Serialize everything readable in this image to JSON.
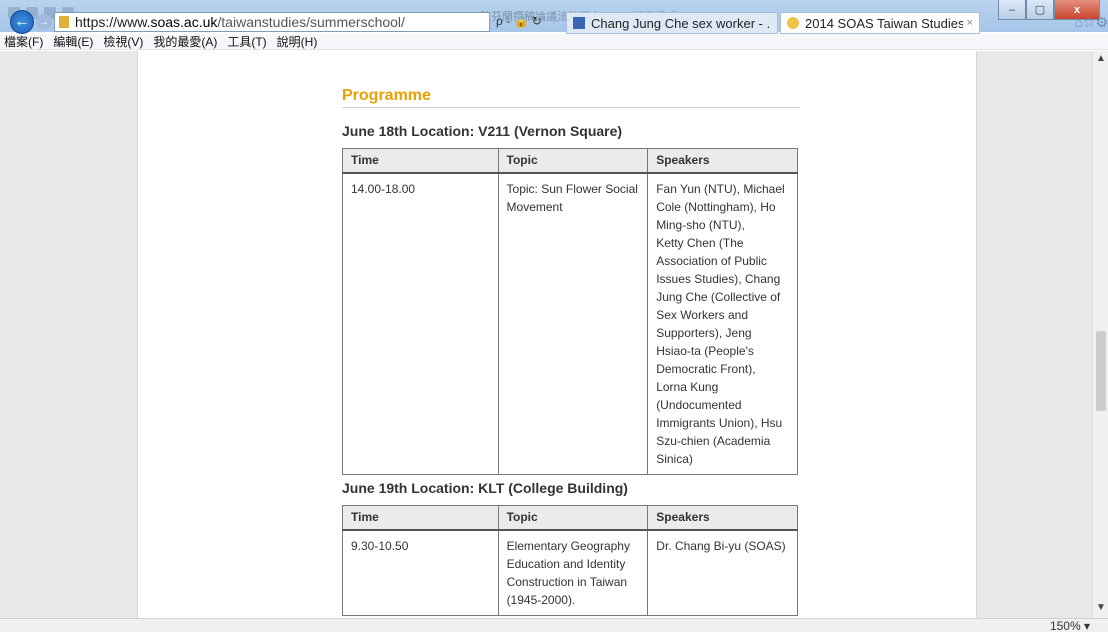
{
  "window": {
    "title": "陳芬蘭撰稿論議法律研究.docx [相容模式] - Word",
    "controls": {
      "minimize": "–",
      "maximize": "▢",
      "close": "x"
    }
  },
  "browser": {
    "address": {
      "scheme": "https://www.",
      "host": "soas.ac.uk",
      "path": "/taiwanstudies/summerschool/"
    },
    "address_tools": "ρ - 🔒 ↻",
    "tabs": [
      {
        "label": "Chang Jung Che sex worker - ...",
        "active": false
      },
      {
        "label": "2014 SOAS Taiwan Studies ...",
        "close": "×",
        "active": true
      }
    ],
    "right_icons": "⌂☆⚙"
  },
  "menubar": [
    "檔案(F)",
    "編輯(E)",
    "檢視(V)",
    "我的最愛(A)",
    "工具(T)",
    "說明(H)"
  ],
  "page": {
    "section_title": "Programme",
    "days": [
      {
        "heading": "June 18th Location: V211 (Vernon Square)",
        "columns": [
          "Time",
          "Topic",
          "Speakers"
        ],
        "rows": [
          {
            "time": "14.00-18.00",
            "topic": "Topic: Sun Flower Social Movement",
            "speakers": "Fan Yun (NTU), Michael Cole (Nottingham), Ho Ming-sho (NTU),\nKetty Chen (The Association of Public Issues Studies), Chang Jung Che (Collective of Sex Workers and Supporters), Jeng Hsiao-ta (People's Democratic Front), Lorna Kung (Undocumented Immigrants Union), Hsu Szu-chien (Academia Sinica)"
          }
        ]
      },
      {
        "heading": "June 19th Location: KLT (College Building)",
        "columns": [
          "Time",
          "Topic",
          "Speakers"
        ],
        "rows": [
          {
            "time": "9.30-10.50",
            "topic": "Elementary Geography Education and Identity Construction in Taiwan (1945-2000).",
            "speakers": "Dr. Chang Bi-yu (SOAS)"
          }
        ]
      }
    ]
  },
  "status": {
    "zoom": "150%  ▾"
  }
}
